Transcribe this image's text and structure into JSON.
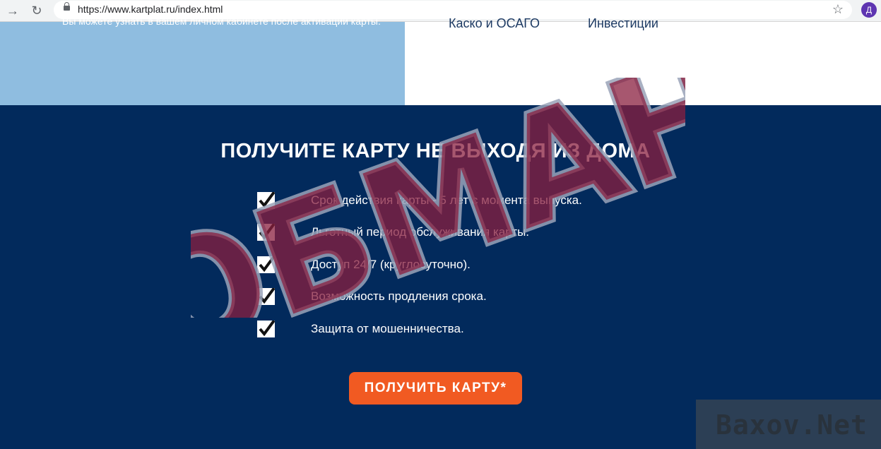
{
  "browser": {
    "url": "https://www.kartplat.ru/index.html",
    "avatar_letter": "Д",
    "icons": [
      "forward-icon",
      "reload-icon",
      "lock-icon",
      "star-icon"
    ]
  },
  "top": {
    "left_text": "Вы можете узнать в вашем личном кабинете после активации карты.",
    "services": [
      "Каско и ОСАГО",
      "Инвестиции"
    ]
  },
  "main": {
    "headline": "ПОЛУЧИТЕ КАРТУ НЕ ВЫХОДЯ ИЗ ДОМА",
    "features": [
      "Срок действия карты - 5 лет с момента выпуска.",
      "Льготный период обслуживания карты.",
      "Доступ 24/7 (круглосуточно).",
      "Возможность продления срока.",
      "Защита от мошенничества."
    ],
    "cta_label": "ПОЛУЧИТЬ КАРТУ*"
  },
  "overlay": {
    "stamp_text": "ОБМАН",
    "watermark_text": "Baxov.Net"
  },
  "colors": {
    "background": "#022a5c",
    "light_blue": "#8fbde0",
    "cta": "#f15a22",
    "stamp_fill": "#8a1f3f",
    "stamp_outline": "#9aa3b8"
  }
}
